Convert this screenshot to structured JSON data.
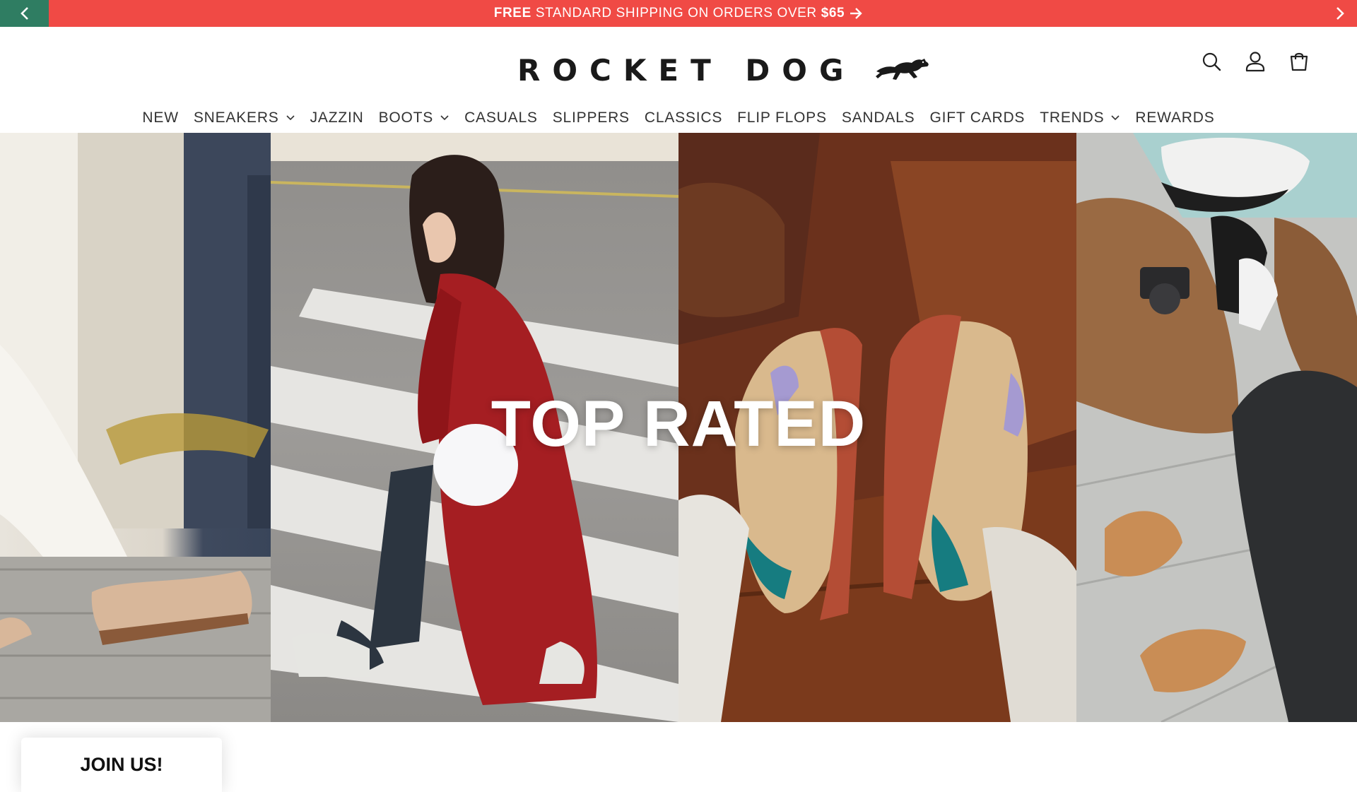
{
  "announcement": {
    "lead": "FREE",
    "middle": "STANDARD SHIPPING ON ORDERS OVER",
    "amount": "$65",
    "bar_color": "#f04a45",
    "prev_color": "#2f7d62"
  },
  "header": {
    "logo_text": "ROCKET DOG",
    "icons": [
      "search-icon",
      "account-icon",
      "cart-icon"
    ]
  },
  "nav": {
    "items": [
      {
        "label": "NEW",
        "dropdown": false
      },
      {
        "label": "SNEAKERS",
        "dropdown": true
      },
      {
        "label": "JAZZIN",
        "dropdown": false
      },
      {
        "label": "BOOTS",
        "dropdown": true
      },
      {
        "label": "CASUALS",
        "dropdown": false
      },
      {
        "label": "SLIPPERS",
        "dropdown": false
      },
      {
        "label": "CLASSICS",
        "dropdown": false
      },
      {
        "label": "FLIP FLOPS",
        "dropdown": false
      },
      {
        "label": "SANDALS",
        "dropdown": false
      },
      {
        "label": "GIFT CARDS",
        "dropdown": false
      },
      {
        "label": "TRENDS",
        "dropdown": true
      },
      {
        "label": "REWARDS",
        "dropdown": false
      }
    ]
  },
  "hero": {
    "title": "TOP RATED"
  },
  "join": {
    "label": "JOIN US!"
  }
}
